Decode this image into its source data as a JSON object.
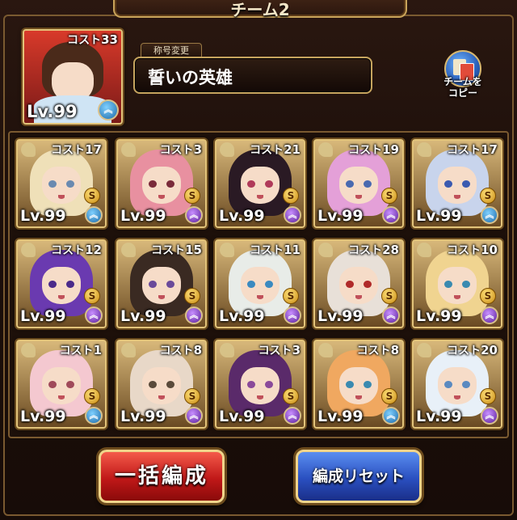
{
  "team_title": "チーム2",
  "leader": {
    "cost_label": "コスト",
    "cost": "33",
    "level": "Lv.99",
    "rank": "blue"
  },
  "title_change_label": "称号変更",
  "player_title": "誓いの英雄",
  "copy_button": {
    "label_line1": "チームを",
    "label_line2": "コピー"
  },
  "units": [
    {
      "cost_label": "コスト",
      "cost": "17",
      "level": "Lv.99",
      "rank": "blue"
    },
    {
      "cost_label": "コスト",
      "cost": "3",
      "level": "Lv.99",
      "rank": "purple"
    },
    {
      "cost_label": "コスト",
      "cost": "21",
      "level": "Lv.99",
      "rank": "purple"
    },
    {
      "cost_label": "コスト",
      "cost": "19",
      "level": "Lv.99",
      "rank": "purple"
    },
    {
      "cost_label": "コスト",
      "cost": "17",
      "level": "Lv.99",
      "rank": "blue"
    },
    {
      "cost_label": "コスト",
      "cost": "12",
      "level": "Lv.99",
      "rank": "purple"
    },
    {
      "cost_label": "コスト",
      "cost": "15",
      "level": "Lv.99",
      "rank": "purple"
    },
    {
      "cost_label": "コスト",
      "cost": "11",
      "level": "Lv.99",
      "rank": "purple"
    },
    {
      "cost_label": "コスト",
      "cost": "28",
      "level": "Lv.99",
      "rank": "purple"
    },
    {
      "cost_label": "コスト",
      "cost": "10",
      "level": "Lv.99",
      "rank": "purple"
    },
    {
      "cost_label": "コスト",
      "cost": "1",
      "level": "Lv.99",
      "rank": "blue"
    },
    {
      "cost_label": "コスト",
      "cost": "8",
      "level": "Lv.99",
      "rank": "purple"
    },
    {
      "cost_label": "コスト",
      "cost": "3",
      "level": "Lv.99",
      "rank": "purple"
    },
    {
      "cost_label": "コスト",
      "cost": "8",
      "level": "Lv.99",
      "rank": "blue"
    },
    {
      "cost_label": "コスト",
      "cost": "20",
      "level": "Lv.99",
      "rank": "purple"
    }
  ],
  "rarity_badge": "S",
  "rank_badge_glyph": "︽",
  "buttons": {
    "bulk_form": "一括編成",
    "reset_form": "編成リセット"
  },
  "colors": {
    "gold_border": "#e3c47a",
    "red_button": "#c01818",
    "blue_button": "#2a4fc0",
    "rank_blue": "#1e6aa8",
    "rank_purple": "#5a1e9a"
  }
}
